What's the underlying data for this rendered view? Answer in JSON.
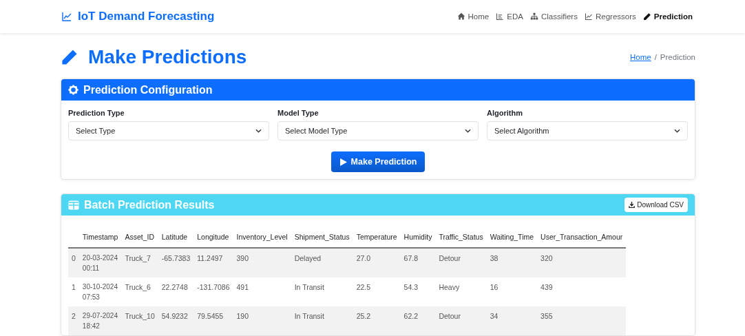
{
  "navbar": {
    "brand": "IoT Demand Forecasting",
    "links": [
      {
        "label": "Home",
        "selected": false
      },
      {
        "label": "EDA",
        "selected": false
      },
      {
        "label": "Classifiers",
        "selected": false
      },
      {
        "label": "Regressors",
        "selected": false
      },
      {
        "label": "Prediction",
        "selected": true
      }
    ]
  },
  "page": {
    "title": "Make Predictions",
    "breadcrumb": [
      {
        "kind": "link",
        "label": "Home"
      },
      {
        "kind": "separator",
        "label": "/"
      },
      {
        "kind": "current",
        "label": "Prediction"
      }
    ]
  },
  "config_card": {
    "title": "Prediction Configuration",
    "fields": [
      {
        "label": "Prediction Type",
        "value": "Select Type"
      },
      {
        "label": "Model Type",
        "value": "Select Model Type"
      },
      {
        "label": "Algorithm",
        "value": "Select Algorithm"
      }
    ],
    "button": "Make Prediction"
  },
  "results_card": {
    "title": "Batch Prediction Results",
    "download": "Download CSV",
    "table": {
      "columns": [
        "",
        "Timestamp",
        "Asset_ID",
        "Latitude",
        "Longitude",
        "Inventory_Level",
        "Shipment_Status",
        "Temperature",
        "Humidity",
        "Traffic_Status",
        "Waiting_Time",
        "User_Transaction_Amour"
      ],
      "rows": [
        [
          "0",
          "20-03-2024 00:11",
          "Truck_7",
          "-65.7383",
          "11.2497",
          "390",
          "Delayed",
          "27.0",
          "67.8",
          "Detour",
          "38",
          "320"
        ],
        [
          "1",
          "30-10-2024 07:53",
          "Truck_6",
          "22.2748",
          "-131.7086",
          "491",
          "In Transit",
          "22.5",
          "54.3",
          "Heavy",
          "16",
          "439"
        ],
        [
          "2",
          "29-07-2024 18:42",
          "Truck_10",
          "54.9232",
          "79.5455",
          "190",
          "In Transit",
          "25.2",
          "62.2",
          "Detour",
          "34",
          "355"
        ]
      ]
    }
  }
}
